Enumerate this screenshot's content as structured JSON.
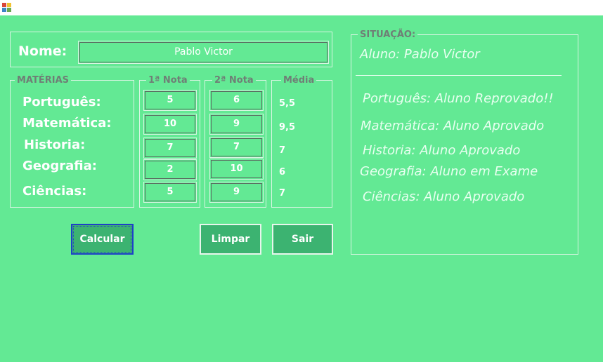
{
  "window": {
    "icon": "app-window-icon"
  },
  "nome": {
    "label": "Nome:",
    "value": "Pablo Victor"
  },
  "groups": {
    "materias": "MATÉRIAS",
    "nota1": "1ª Nota",
    "nota2": "2ª Nota",
    "media": "Média",
    "situacao": "SITUAÇÃO:"
  },
  "subjects": [
    {
      "name": "Português:",
      "nota1": "5",
      "nota2": "6",
      "media": "5,5"
    },
    {
      "name": "Matemática:",
      "nota1": "10",
      "nota2": "9",
      "media": "9,5"
    },
    {
      "name": "Historia:",
      "nota1": "7",
      "nota2": "7",
      "media": "7"
    },
    {
      "name": "Geografia:",
      "nota1": "2",
      "nota2": "10",
      "media": "6"
    },
    {
      "name": "Ciências:",
      "nota1": "5",
      "nota2": "9",
      "media": "7"
    }
  ],
  "buttons": {
    "calcular": "Calcular",
    "limpar": "Limpar",
    "sair": "Sair"
  },
  "situacao": {
    "aluno": "Aluno: Pablo Victor",
    "lines": [
      "Português: Aluno Reprovado!!",
      "Matemática: Aluno Aprovado",
      "Historia: Aluno Aprovado",
      "Geografia: Aluno em Exame",
      "Ciências: Aluno Aprovado"
    ]
  }
}
